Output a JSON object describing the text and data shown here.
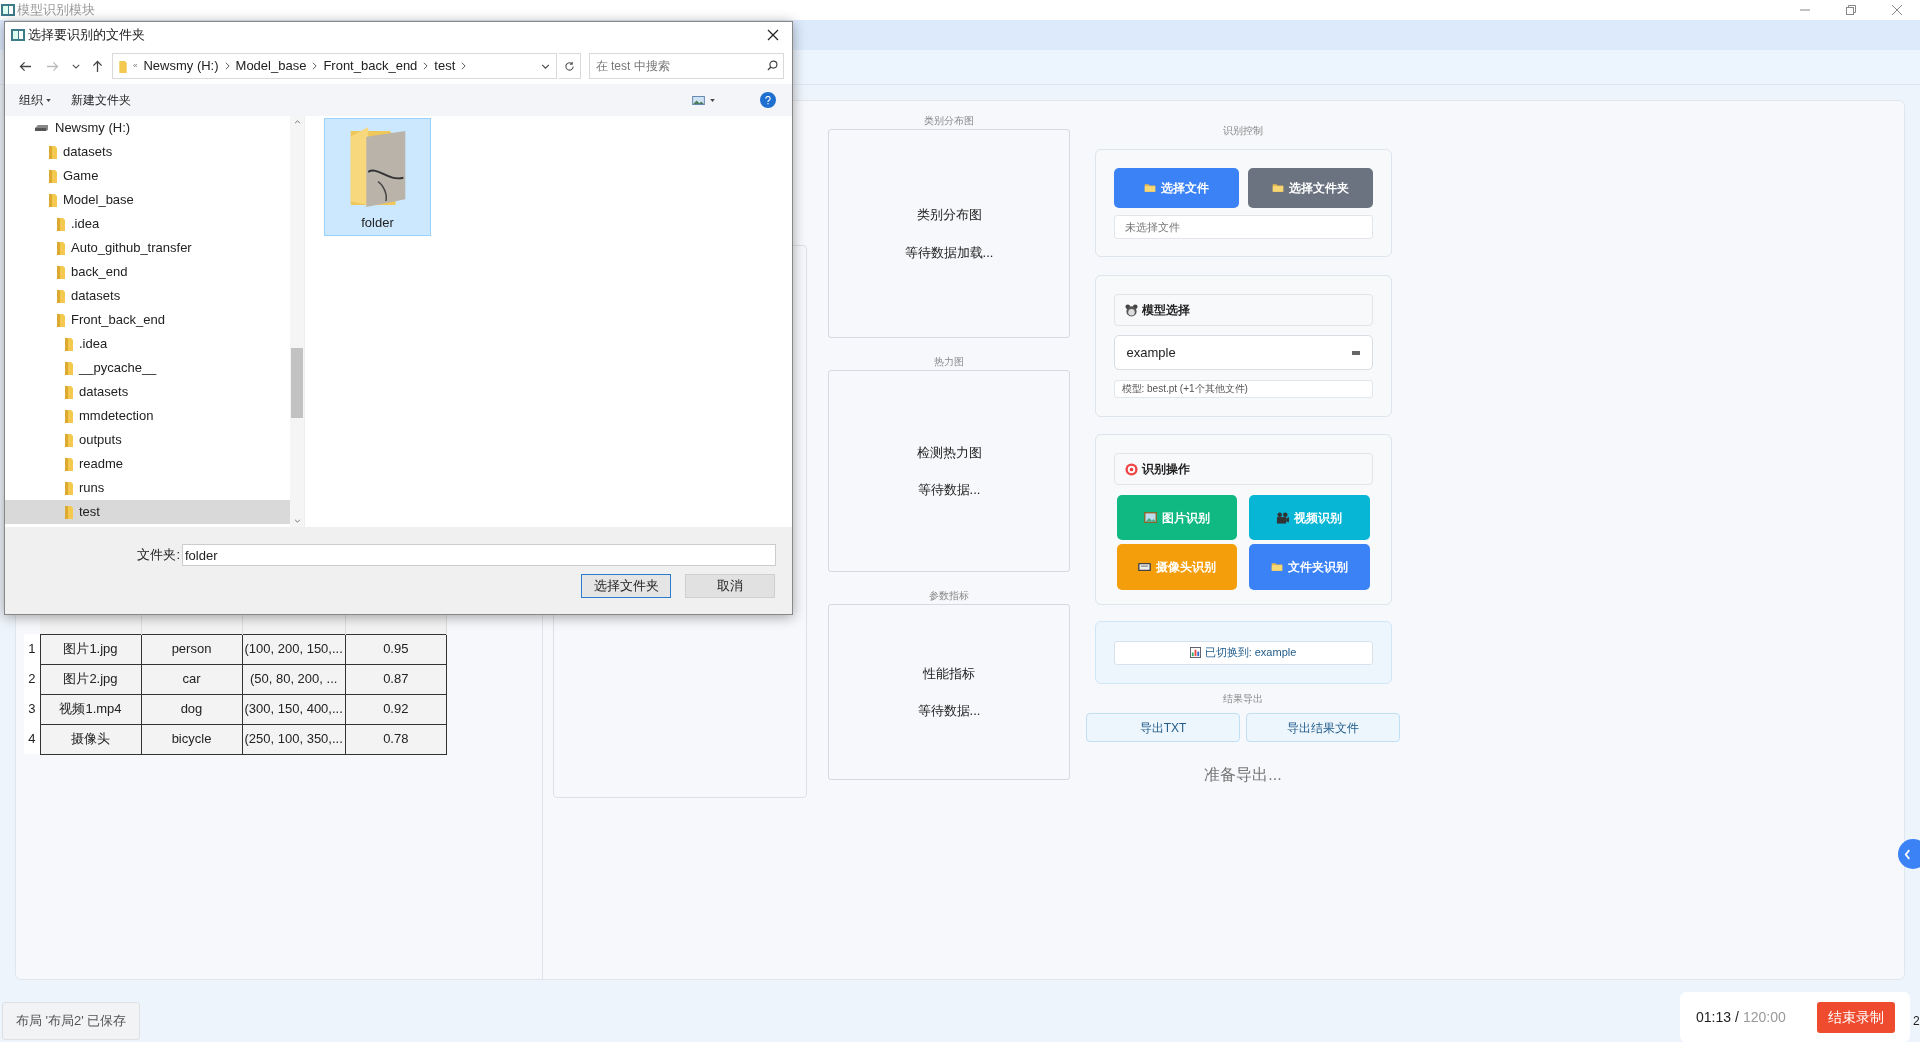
{
  "app": {
    "title": "模型识别模块"
  },
  "dialog": {
    "title": "选择要识别的文件夹",
    "path_overflow": "«",
    "breadcrumb": [
      "Newsmy (H:)",
      "Model_base",
      "Front_back_end",
      "test"
    ],
    "search": {
      "placeholder": "在 test 中搜索"
    },
    "toolbar": [
      {
        "label": "组织",
        "kind": "menu"
      },
      {
        "label": "新建文件夹",
        "kind": "plain"
      }
    ],
    "tree": [
      {
        "label": "Newsmy (H:)",
        "kind": "drive",
        "selected": false,
        "children": [
          {
            "label": "datasets",
            "kind": "folder",
            "selected": false
          },
          {
            "label": "Game",
            "kind": "folder",
            "selected": false
          },
          {
            "label": "Model_base",
            "kind": "folder",
            "selected": false,
            "children": [
              {
                "label": ".idea",
                "kind": "folder",
                "selected": false
              },
              {
                "label": "Auto_github_transfer",
                "kind": "folder",
                "selected": false
              },
              {
                "label": "back_end",
                "kind": "folder",
                "selected": false
              },
              {
                "label": "datasets",
                "kind": "folder",
                "selected": false
              },
              {
                "label": "Front_back_end",
                "kind": "folder",
                "selected": false,
                "children": [
                  {
                    "label": ".idea",
                    "kind": "folder",
                    "selected": false
                  },
                  {
                    "label": "__pycache__",
                    "kind": "folder",
                    "selected": false
                  },
                  {
                    "label": "datasets",
                    "kind": "folder",
                    "selected": false
                  },
                  {
                    "label": "mmdetection",
                    "kind": "folder",
                    "selected": false
                  },
                  {
                    "label": "outputs",
                    "kind": "folder",
                    "selected": false
                  },
                  {
                    "label": "readme",
                    "kind": "folder",
                    "selected": false
                  },
                  {
                    "label": "runs",
                    "kind": "folder",
                    "selected": false
                  },
                  {
                    "label": "test",
                    "kind": "folder",
                    "selected": true
                  }
                ]
              }
            ]
          }
        ]
      }
    ],
    "files": [
      {
        "label": "folder",
        "selected": true
      }
    ],
    "folder_field": {
      "label": "文件夹:",
      "value": "folder"
    },
    "buttons": [
      {
        "label": "选择文件夹",
        "kind": "default"
      },
      {
        "label": "取消",
        "kind": "plain"
      }
    ]
  },
  "results_table": {
    "rows": [
      {
        "index": "1",
        "cells": [
          "图片1.jpg",
          "person",
          "(100, 200, 150,...",
          "0.95"
        ]
      },
      {
        "index": "2",
        "cells": [
          "图片2.jpg",
          "car",
          "(50, 80, 200, ...",
          "0.87"
        ]
      },
      {
        "index": "3",
        "cells": [
          "视频1.mp4",
          "dog",
          "(300, 150, 400,...",
          "0.92"
        ]
      },
      {
        "index": "4",
        "cells": [
          "摄像头",
          "bicycle",
          "(250, 100, 350,...",
          "0.78"
        ]
      }
    ]
  },
  "chart_panels": [
    {
      "label": "类别分布图",
      "title": "类别分布图",
      "status": "等待数据加载..."
    },
    {
      "label": "热力图",
      "title": "检测热力图",
      "status": "等待数据..."
    },
    {
      "label": "参数指标",
      "title": "性能指标",
      "status": "等待数据..."
    }
  ],
  "control": {
    "label": "识别控制",
    "buttons": [
      {
        "label": "选择文件",
        "color": "#3b82f6"
      },
      {
        "label": "选择文件夹",
        "color": "#6b7280"
      }
    ],
    "file_field": {
      "placeholder": "未选择文件"
    }
  },
  "model": {
    "header": "模型选择",
    "value": "example",
    "hint": "模型: best.pt (+1个其他文件)"
  },
  "actions": {
    "header": "识别操作",
    "buttons": [
      {
        "label": "图片识别",
        "kind": "image",
        "color": "#10b981"
      },
      {
        "label": "视频识别",
        "kind": "video",
        "color": "#06b6d4"
      },
      {
        "label": "摄像头识别",
        "kind": "camera",
        "color": "#f59e0b"
      },
      {
        "label": "文件夹识别",
        "kind": "folder",
        "color": "#3b82f6"
      }
    ]
  },
  "model_status": "已切换到: example",
  "export": {
    "label": "结果导出",
    "buttons": [
      "导出TXT",
      "导出结果文件"
    ],
    "status": "准备导出..."
  },
  "toast": "布局 '布局2' 已保存",
  "recording": {
    "elapsed": "01:13",
    "separator": "/",
    "limit": "120:00",
    "stop": "结束录制"
  },
  "edge_text": "2"
}
